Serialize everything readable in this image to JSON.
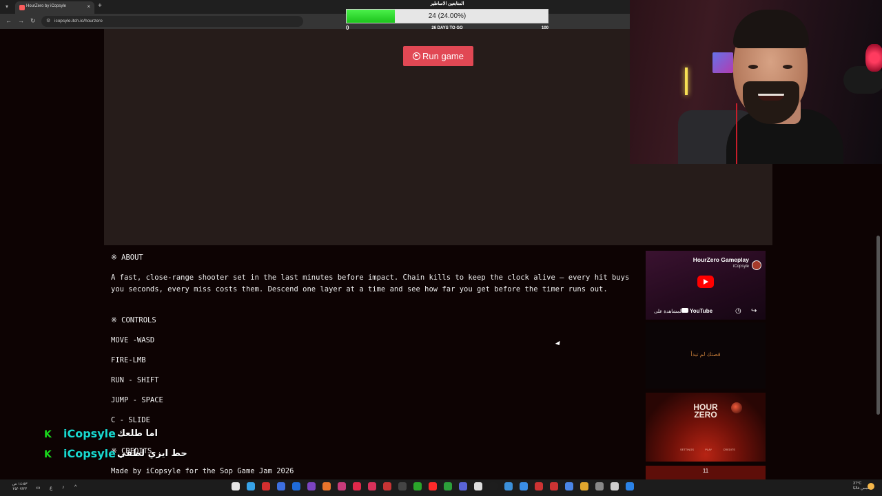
{
  "browser": {
    "tab_title": "HourZero by iCopsyle",
    "url": "icopsyle.itch.io/hourzero",
    "new_tab_label": "+",
    "close_label": "×"
  },
  "goal": {
    "title": "المتابعين الاساطير",
    "progress_text": "24 (24.00%)",
    "progress_fraction": 0.24,
    "min_label": "0",
    "days_label": "26 DAYS TO GO",
    "max_label": "100"
  },
  "game": {
    "run_label": "Run game"
  },
  "description": {
    "about_heading": "※ ABOUT",
    "about_text": "A fast, close-range shooter set in the last minutes before impact. Chain kills to keep the clock alive — every hit buys you seconds, every miss costs them. Descend one layer at a time and see how far you get before the timer runs out.",
    "controls_heading": "※ CONTROLS",
    "controls": [
      "MOVE -WASD",
      "FIRE-LMB",
      "RUN - SHIFT",
      "JUMP - SPACE",
      "C - SLIDE"
    ],
    "credits_heading": "※ CREDITS",
    "credits_text": "Made by iCopsyle for the Sop Game Jam 2026"
  },
  "videos": {
    "v1_title": "HourZero Gameplay",
    "v1_channel": "iCopsyle",
    "v1_watch": "المشاهدة على",
    "v1_youtube": "YouTube",
    "v2_text": "قصتك لم تبدأ",
    "v3_title_1": "HOUR",
    "v3_title_2": "ZERO",
    "v3_nav": [
      "SETTINGS",
      "PLAY",
      "CREDITS"
    ],
    "v4_num": "11"
  },
  "chat": {
    "messages": [
      {
        "badge": "K",
        "user": "iCopsyle",
        "text": "اما طلعك"
      },
      {
        "badge": "K",
        "user": "iCopsyle",
        "text": "حط ايزي لطفي"
      }
    ]
  },
  "taskbar": {
    "clock_time": "١٤:٥٣ ص",
    "clock_date": "٢٥/٠٧/٢٣",
    "lang": "ع",
    "weather_temp": "37°C",
    "weather_desc": "مشمس غالبًا"
  },
  "colors": {
    "run_button": "#e14854",
    "goal_fill": "#2ad62a",
    "chat_user": "#19d9d0",
    "chat_badge": "#19d91c"
  }
}
